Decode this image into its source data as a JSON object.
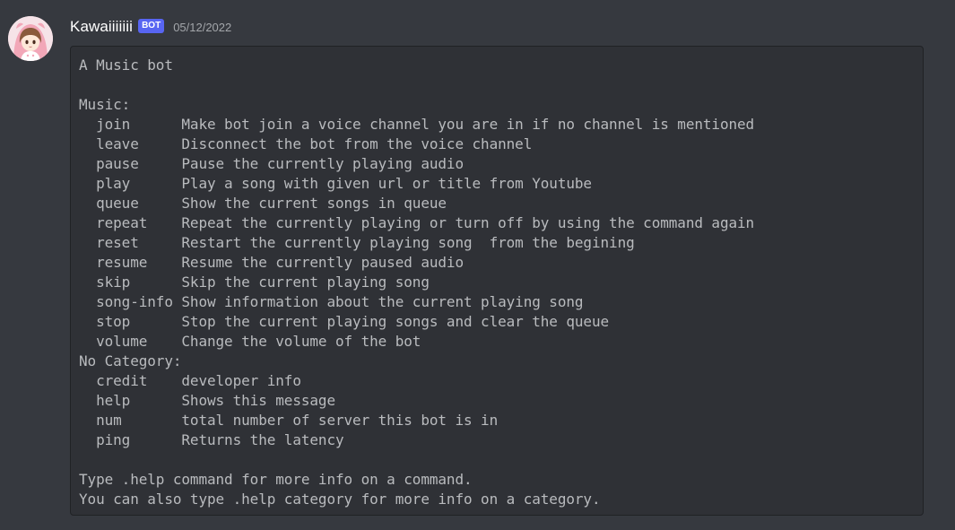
{
  "message": {
    "author": {
      "username": "Kawaiiiiiii",
      "bot_badge": "BOT",
      "avatar_icon": "anime-girl-avatar"
    },
    "timestamp": "05/12/2022",
    "code_lines": [
      "A Music bot",
      "",
      "Music:",
      "  join      Make bot join a voice channel you are in if no channel is mentioned",
      "  leave     Disconnect the bot from the voice channel",
      "  pause     Pause the currently playing audio",
      "  play      Play a song with given url or title from Youtube",
      "  queue     Show the current songs in queue",
      "  repeat    Repeat the currently playing or turn off by using the command again",
      "  reset     Restart the currently playing song  from the begining",
      "  resume    Resume the currently paused audio",
      "  skip      Skip the current playing song",
      "  song-info Show information about the current playing song",
      "  stop      Stop the current playing songs and clear the queue",
      "  volume    Change the volume of the bot",
      "No Category:",
      "  credit    developer info",
      "  help      Shows this message",
      "  num       total number of server this bot is in",
      "  ping      Returns the latency",
      "",
      "Type .help command for more info on a command.",
      "You can also type .help category for more info on a category."
    ]
  },
  "colors": {
    "background": "#36393f",
    "codeblock_bg": "#2f3136",
    "bot_badge": "#5865f2",
    "code_text": "#b9bbbe"
  }
}
